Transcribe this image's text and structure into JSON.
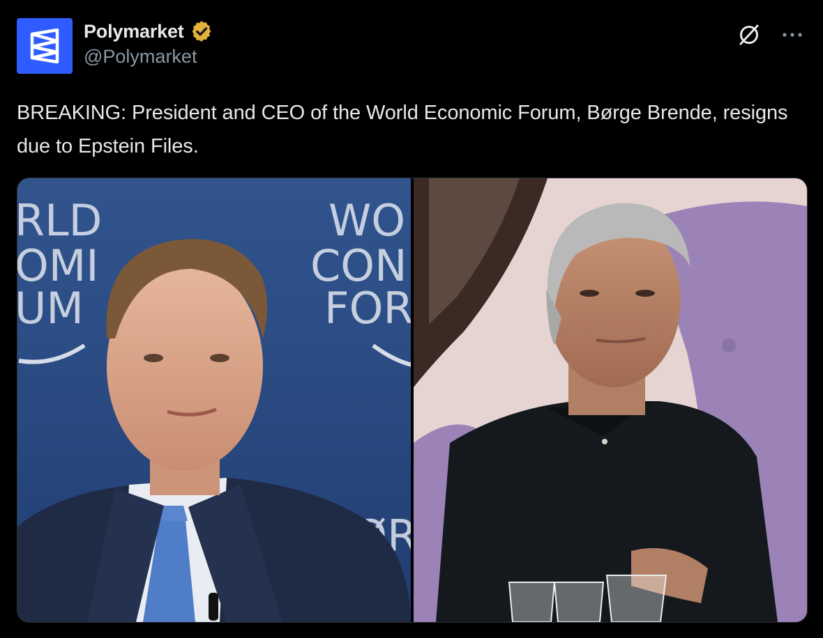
{
  "post": {
    "author": {
      "display_name": "Polymarket",
      "handle": "@Polymarket",
      "verified_icon": "verified-gold-badge-icon",
      "avatar_icon": "polymarket-logo-icon",
      "brand_color": "#2e5cff"
    },
    "text": "BREAKING: President and CEO of the World Economic Forum, Børge Brende, resigns due to Epstein Files.",
    "actions": {
      "grok_icon": "grok-icon",
      "more_icon": "more-options-icon"
    },
    "media": {
      "left_image": {
        "backdrop_lines": [
          "RLD",
          "OMI",
          "UM"
        ],
        "backdrop_lines_right": [
          "WO",
          "CON",
          "FOR"
        ],
        "bottom_text": "WØR"
      },
      "right_image": {}
    }
  },
  "colors": {
    "background": "#000000",
    "text": "#e7e9ea",
    "secondary_text": "#8b98a5",
    "verified_gold": "#e3b23c",
    "wef_blue": "#284a82"
  }
}
